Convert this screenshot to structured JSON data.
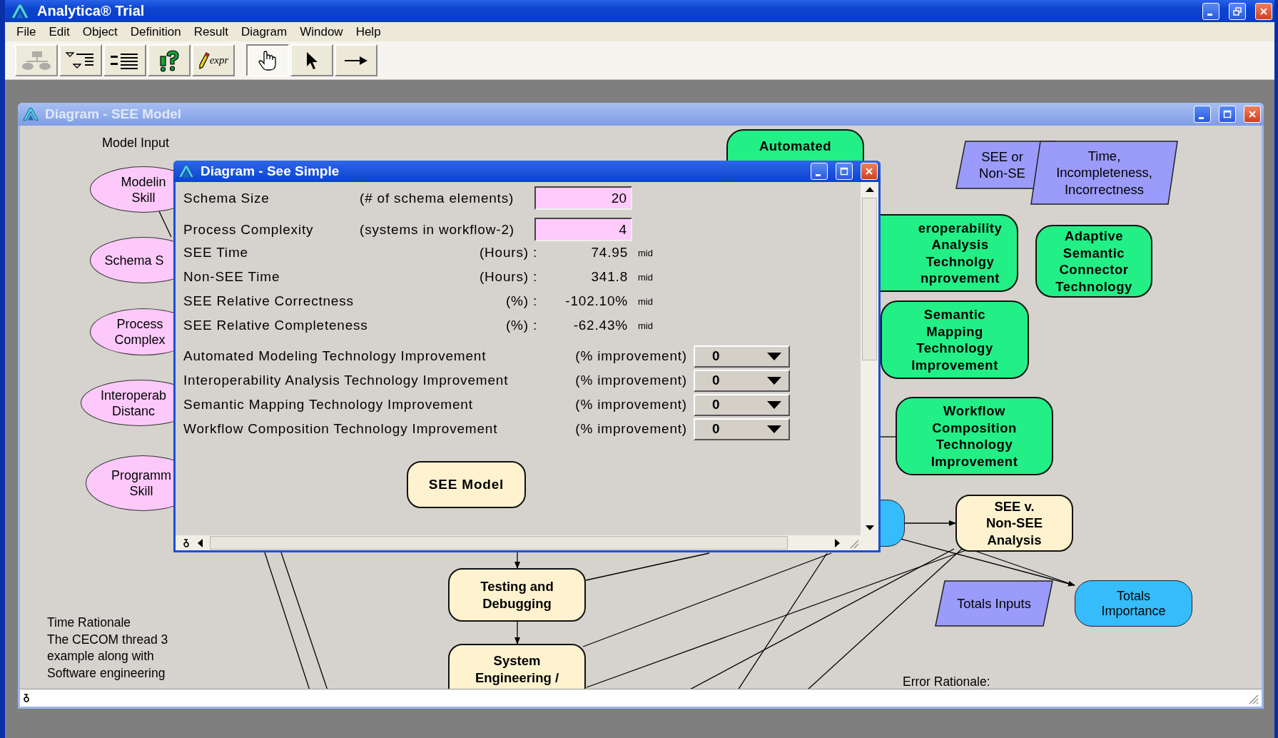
{
  "app": {
    "title": "Analytica® Trial"
  },
  "menu": [
    "File",
    "Edit",
    "Object",
    "Definition",
    "Result",
    "Diagram",
    "Window",
    "Help"
  ],
  "toolbar": [
    {
      "kind": "hierarchy",
      "disabled": true,
      "selected": false
    },
    {
      "kind": "outline",
      "disabled": false,
      "selected": false
    },
    {
      "kind": "list",
      "disabled": false,
      "selected": false
    },
    {
      "kind": "help",
      "disabled": false,
      "selected": false
    },
    {
      "kind": "expr",
      "label": "expr",
      "disabled": false,
      "selected": false
    },
    {
      "kind": "hand",
      "disabled": false,
      "selected": true
    },
    {
      "kind": "pointer",
      "disabled": false,
      "selected": false
    },
    {
      "kind": "connector",
      "disabled": false,
      "selected": false
    }
  ],
  "diagram_window": {
    "title": "Diagram - SEE Model",
    "nodes": [
      {
        "kind": "chance",
        "lines": [
          "Modelin",
          "Skill"
        ]
      },
      {
        "kind": "chance",
        "lines": [
          "Schema S"
        ]
      },
      {
        "kind": "chance",
        "lines": [
          "Process",
          "Complex"
        ]
      },
      {
        "kind": "chance",
        "lines": [
          "Interoperab",
          "Distanc"
        ]
      },
      {
        "kind": "chance",
        "lines": [
          "Programm",
          "Skill"
        ]
      },
      {
        "kind": "decision",
        "lines": [
          "Automated"
        ]
      },
      {
        "kind": "constant",
        "lines": [
          "SEE or",
          "Non-SE"
        ]
      },
      {
        "kind": "constant",
        "lines": [
          "Time,",
          "Incompleteness,",
          "Incorrectness"
        ]
      },
      {
        "kind": "decision",
        "lines": [
          "eroperability",
          "Analysis",
          "Technolgy",
          "nprovement"
        ]
      },
      {
        "kind": "decision",
        "lines": [
          "Adaptive",
          "Semantic",
          "Connector",
          "Technology"
        ]
      },
      {
        "kind": "decision",
        "lines": [
          "Semantic",
          "Mapping",
          "Technology",
          "Improvement"
        ]
      },
      {
        "kind": "decision",
        "lines": [
          "Workflow",
          "Composition",
          "Technology",
          "Improvement"
        ]
      },
      {
        "kind": "variable"
      },
      {
        "kind": "objective",
        "lines": [
          "SEE v.",
          "Non-SEE",
          "Analysis"
        ]
      },
      {
        "kind": "constant",
        "lines": [
          "Totals Inputs"
        ]
      },
      {
        "kind": "variable",
        "lines": [
          "Totals",
          "Importance"
        ]
      },
      {
        "kind": "objective",
        "lines": [
          "Testing and",
          "Debugging"
        ]
      },
      {
        "kind": "objective",
        "lines": [
          "System",
          "Engineering /"
        ]
      }
    ],
    "notes": [
      {
        "lines": [
          "Model Input"
        ]
      },
      {
        "lines": [
          "Time Rationale",
          "The CECOM thread 3",
          "example along with",
          "Software engineering"
        ]
      },
      {
        "lines": [
          "Error Rationale:"
        ]
      }
    ]
  },
  "dialog": {
    "title": "Diagram - See Simple",
    "inputs": [
      {
        "label": "Schema Size",
        "unit": "(# of schema elements)",
        "value": "20"
      },
      {
        "label": "Process Complexity",
        "unit": "(systems in workflow-2)",
        "value": "4"
      }
    ],
    "outputs": [
      {
        "label": "SEE Time",
        "unit": "(Hours) :",
        "value": "74.95",
        "tag": "mid"
      },
      {
        "label": "Non-SEE Time",
        "unit": "(Hours) :",
        "value": "341.8",
        "tag": "mid"
      },
      {
        "label": "SEE Relative Correctness",
        "unit": "(%) :",
        "value": "-102.10%",
        "tag": "mid"
      },
      {
        "label": "SEE Relative Completeness",
        "unit": "(%) :",
        "value": "-62.43%",
        "tag": "mid"
      }
    ],
    "choices": [
      {
        "label": "Automated Modeling Technology Improvement",
        "unit": "(% improvement)",
        "value": "0"
      },
      {
        "label": "Interoperability Analysis Technology Improvement",
        "unit": "(% improvement)",
        "value": "0"
      },
      {
        "label": "Semantic Mapping Technology Improvement",
        "unit": "(% improvement)",
        "value": "0"
      },
      {
        "label": "Workflow Composition Technology Improvement",
        "unit": "(% improvement)",
        "value": "0"
      }
    ],
    "button": "SEE Model"
  }
}
